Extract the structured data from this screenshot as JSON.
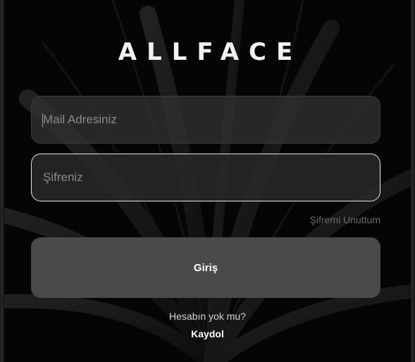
{
  "app": {
    "logo": "ALLFACE"
  },
  "login_form": {
    "email_placeholder": "Mail Adresiniz",
    "email_value": "",
    "password_placeholder": "Şifreniz",
    "password_value": "",
    "forgot_password_label": "Şifremi Unuttum",
    "login_button_label": "Giriş"
  },
  "signup": {
    "prompt": "Hesabın yok mu?",
    "link_label": "Kaydol"
  },
  "colors": {
    "background": "#0a0a0a",
    "field_background": "#303030",
    "focused_border": "#e6e6e6",
    "button_background": "#4a4a4a",
    "muted_text": "#6a6a6a"
  },
  "background_image": "dark-palm-leaf"
}
